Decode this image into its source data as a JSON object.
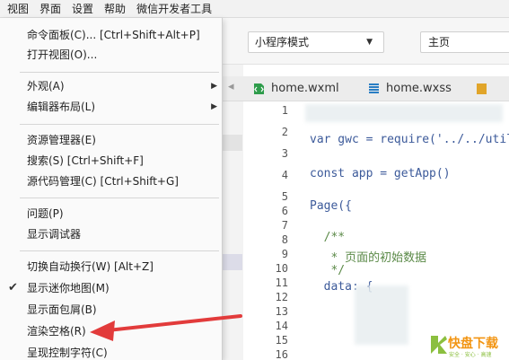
{
  "menubar": {
    "items": [
      "视图",
      "界面",
      "设置",
      "帮助",
      "微信开发者工具"
    ]
  },
  "toolbar": {
    "mode_value": "小程序模式",
    "page_value": "主页"
  },
  "tabs": {
    "nav": "◂",
    "items": [
      {
        "label": "home.wxml",
        "icon": "wxml-file-icon",
        "color": "#2e9c4b"
      },
      {
        "label": "home.wxss",
        "icon": "wxss-file-icon",
        "color": "#2a7ec4"
      },
      {
        "label": "",
        "icon": "js-file-icon",
        "color": "#e1a52a"
      }
    ]
  },
  "dropdown": {
    "items": [
      {
        "label": "命令面板(C)...  [Ctrl+Shift+Alt+P]"
      },
      {
        "label": "打开视图(O)..."
      },
      {
        "label": "外观(A)",
        "submenu": true
      },
      {
        "label": "编辑器布局(L)",
        "submenu": true
      },
      {
        "label": "资源管理器(E)"
      },
      {
        "label": "搜索(S)  [Ctrl+Shift+F]"
      },
      {
        "label": "源代码管理(C)  [Ctrl+Shift+G]"
      },
      {
        "label": "问题(P)"
      },
      {
        "label": "显示调试器"
      },
      {
        "label": "切换自动换行(W)  [Alt+Z]"
      },
      {
        "label": "显示迷你地图(M)",
        "checked": true
      },
      {
        "label": "显示面包屑(B)"
      },
      {
        "label": "渲染空格(R)"
      },
      {
        "label": "呈现控制字符(C)"
      }
    ]
  },
  "editor": {
    "line_numbers": [
      "1",
      "2",
      "3",
      "4",
      "5",
      "6",
      "7",
      "8",
      "9",
      "10",
      "11",
      "12",
      "13",
      "14",
      "15",
      "16"
    ],
    "code": {
      "l2": "var gwc = require('../../util",
      "l4": "const app = getApp()",
      "l6": "Page({",
      "l8": "  /**",
      "l9": "   * 页面的初始数据",
      "l10": "   */",
      "l11": "  data: {"
    }
  },
  "watermark": {
    "brand": "快盘下载",
    "sub": "安全 · 安心 · 高速"
  },
  "colors": {
    "annotation_arrow": "#e23b3b",
    "code_keyword": "#3c5a9a",
    "code_comment": "#5b8a48"
  }
}
